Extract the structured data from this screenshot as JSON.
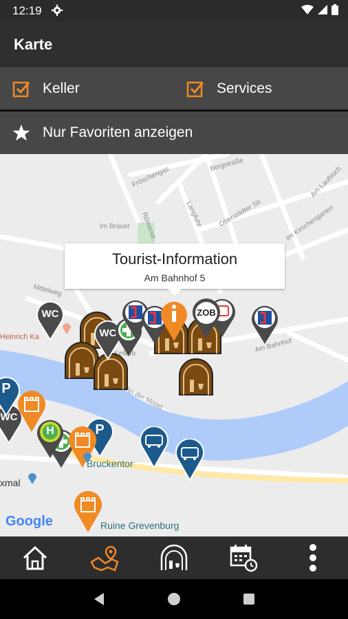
{
  "status": {
    "time": "12:19"
  },
  "app": {
    "title": "Karte"
  },
  "filters": [
    {
      "label": "Keller",
      "checked": true
    },
    {
      "label": "Services",
      "checked": true
    }
  ],
  "favorites": {
    "label": "Nur Favoriten anzeigen"
  },
  "map": {
    "streets": [
      "Bergstraße",
      "Fröschengas",
      "Im Brauer",
      "Langfuhr",
      "Oberstädter Str.",
      "Am Laubloch",
      "Im Kirschengarten",
      "Römerstr.",
      "Mittelweg",
      "An der Mosel",
      "Am Bahnhof",
      "Heinrich Ka",
      "Kellerb"
    ],
    "places": [
      "Bruckentor",
      "Ruine Grevenburg",
      "xmal"
    ],
    "popup": {
      "title": "Tourist-Information",
      "subtitle": "Am Bahnhof 5"
    },
    "logo": "Google",
    "marker_labels": {
      "wc": "WC",
      "zob": "ZOB",
      "parking": "P",
      "h": "H"
    }
  },
  "colors": {
    "accent": "#f08a24",
    "bar": "#2f2f2f",
    "filter_bg": "#474747",
    "river": "#aecbfa",
    "bus_marker": "#1c5a8c",
    "cellar_marker": "#7a4a10"
  },
  "nav": [
    "home-icon",
    "map-icon",
    "cellar-icon",
    "calendar-icon",
    "more-icon"
  ]
}
